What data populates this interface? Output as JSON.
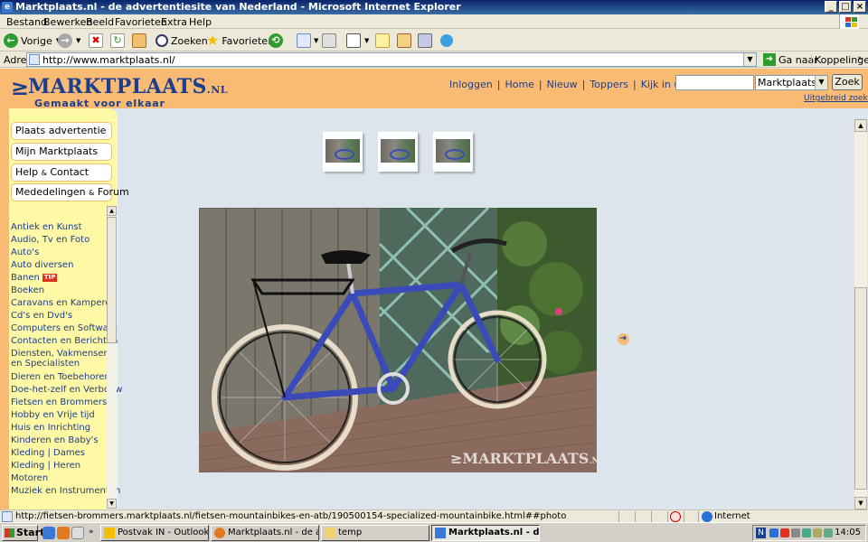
{
  "window": {
    "title": "Marktplaats.nl - de advertentiesite van Nederland - Microsoft Internet Explorer",
    "controls": [
      "_",
      "□",
      "×"
    ]
  },
  "menu": [
    "Bestand",
    "Bewerken",
    "Beeld",
    "Favorieten",
    "Extra",
    "Help"
  ],
  "toolbar": {
    "back": "Vorige",
    "search": "Zoeken",
    "favorites": "Favorieten"
  },
  "address": {
    "label": "Adres",
    "url": "http://www.marktplaats.nl/",
    "go": "Ga naar",
    "links": "Koppelingen"
  },
  "site": {
    "logo": "MARKTPLAATS",
    "logo_suffix": ".NL",
    "slogan": "Gemaakt voor elkaar",
    "nav": [
      "Inloggen",
      "Home",
      "Nieuw",
      "Toppers",
      "Kijk in uw wijk"
    ],
    "search_input": "",
    "search_select": "Marktplaats.nl",
    "search_button": "Zoek",
    "advanced_search": "Uitgebreid zoeken",
    "side_buttons": {
      "post": "Plaats advertentie",
      "my": "Mijn Marktplaats",
      "help_a": "Help",
      "help_b": "Contact",
      "news_a": "Mededelingen",
      "news_b": "Forum"
    },
    "tip_badge": "TIP",
    "categories": [
      "Antiek en Kunst",
      "Audio, Tv en Foto",
      "Auto's",
      "Auto diversen",
      "Banen",
      "Boeken",
      "Caravans en Kamperen",
      "Cd's en Dvd's",
      "Computers en Software",
      "Contacten en Berichten",
      "Diensten, Vakmensen",
      "en Specialisten",
      "Dieren en Toebehoren",
      "Doe-het-zelf en Verbouw",
      "Fietsen en Brommers",
      "Hobby en Vrije tijd",
      "Huis en Inrichting",
      "Kinderen en Baby's",
      "Kleding | Dames",
      "Kleding | Heren",
      "Motoren",
      "Muziek en Instrumenten"
    ],
    "watermark": "MARKTPLAATS",
    "watermark_suffix": ".NL"
  },
  "status": {
    "text": "http://fietsen-brommers.marktplaats.nl/fietsen-mountainbikes-en-atb/190500154-specialized-mountainbike.html##photo",
    "zone": "Internet"
  },
  "taskbar": {
    "start": "Start",
    "tasks": [
      "Postvak IN - Outlook Exp...",
      "Marktplaats.nl - de adve...",
      "temp",
      "Marktplaats.nl - de a..."
    ],
    "tray_lang": "N",
    "clock": "14:05"
  },
  "colors": {
    "brand_orange": "#f9ba73",
    "brand_blue": "#1c3e8c",
    "sidebar_yellow": "#fff8a4",
    "page_bg": "#dce4ec"
  }
}
